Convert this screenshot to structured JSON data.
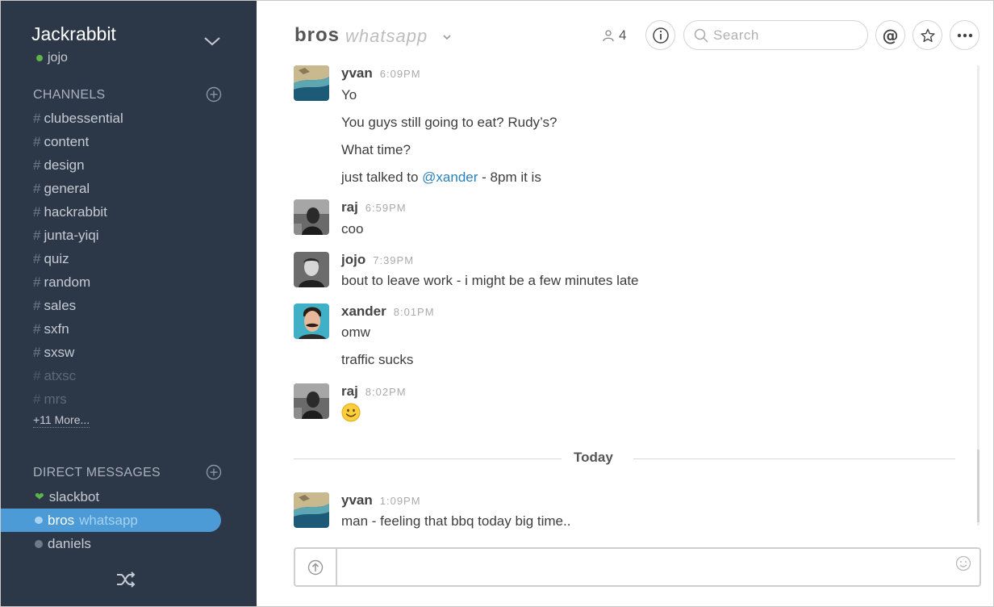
{
  "team": {
    "name": "Jackrabbit",
    "user": "jojo"
  },
  "sidebar": {
    "channels_header": "CHANNELS",
    "channels": [
      {
        "name": "clubessential",
        "muted": false
      },
      {
        "name": "content",
        "muted": false
      },
      {
        "name": "design",
        "muted": false
      },
      {
        "name": "general",
        "muted": false
      },
      {
        "name": "hackrabbit",
        "muted": false
      },
      {
        "name": "junta-yiqi",
        "muted": false
      },
      {
        "name": "quiz",
        "muted": false
      },
      {
        "name": "random",
        "muted": false
      },
      {
        "name": "sales",
        "muted": false
      },
      {
        "name": "sxfn",
        "muted": false
      },
      {
        "name": "sxsw",
        "muted": false
      },
      {
        "name": "atxsc",
        "muted": true
      },
      {
        "name": "mrs",
        "muted": true
      }
    ],
    "more_label": "+11 More...",
    "dm_header": "DIRECT MESSAGES",
    "dms": [
      {
        "name": "slackbot",
        "sub": "",
        "status": "heart",
        "active": false
      },
      {
        "name": "bros",
        "sub": "whatsapp",
        "status": "bubble",
        "active": true
      },
      {
        "name": "daniels",
        "sub": "",
        "status": "away",
        "active": false
      }
    ]
  },
  "header": {
    "title": "bros",
    "purpose": "whatsapp",
    "member_count": "4",
    "search_placeholder": "Search"
  },
  "messages": [
    {
      "author": "yvan",
      "time": "6:09PM",
      "avatar": "beach",
      "lines": [
        "Yo",
        "You guys still going to eat? Rudy’s?",
        "What time?"
      ],
      "mention_line": {
        "before": "just talked to ",
        "mention": "@xander",
        "after": " - 8pm it is"
      }
    },
    {
      "author": "raj",
      "time": "6:59PM",
      "avatar": "bw",
      "lines": [
        "coo"
      ]
    },
    {
      "author": "jojo",
      "time": "7:39PM",
      "avatar": "portrait",
      "lines": [
        "bout to leave work - i might be a few minutes late"
      ]
    },
    {
      "author": "xander",
      "time": "8:01PM",
      "avatar": "mustache",
      "lines": [
        "omw",
        "traffic sucks"
      ]
    },
    {
      "author": "raj",
      "time": "8:02PM",
      "avatar": "bw",
      "lines": [],
      "emoji": "slightly-smiling-face"
    }
  ],
  "divider_label": "Today",
  "today_messages": [
    {
      "author": "yvan",
      "time": "1:09PM",
      "avatar": "beach",
      "lines": [
        "man - feeling that bbq today big time.."
      ]
    }
  ],
  "composer": {
    "placeholder": ""
  },
  "colors": {
    "sidebar_bg": "#2c3848",
    "active_dm": "#4c9ad6",
    "online": "#5fb34b",
    "mention": "#2a80b9"
  }
}
